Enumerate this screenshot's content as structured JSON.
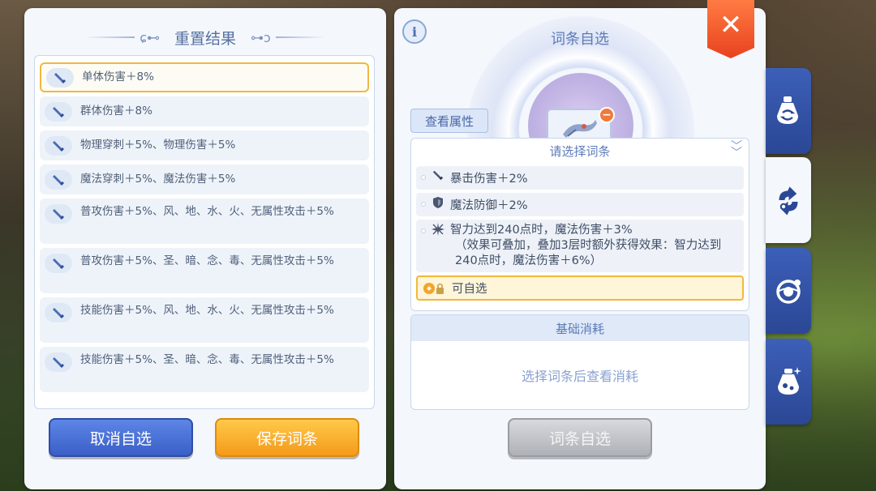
{
  "left_panel": {
    "title": "重置结果",
    "results": [
      {
        "text": "单体伤害＋8%",
        "selected": true
      },
      {
        "text": "群体伤害＋8%",
        "selected": false
      },
      {
        "text": "物理穿刺＋5%、物理伤害＋5%",
        "selected": false
      },
      {
        "text": "魔法穿刺＋5%、魔法伤害＋5%",
        "selected": false
      },
      {
        "text": "普攻伤害＋5%、风、地、水、火、无属性攻击＋5%",
        "selected": false
      },
      {
        "text": "普攻伤害＋5%、圣、暗、念、毒、无属性攻击＋5%",
        "selected": false
      },
      {
        "text": "技能伤害＋5%、风、地、水、火、无属性攻击＋5%",
        "selected": false
      },
      {
        "text": "技能伤害＋5%、圣、暗、念、毒、无属性攻击＋5%",
        "selected": false
      }
    ],
    "cancel_label": "取消自选",
    "save_label": "保存词条"
  },
  "right_panel": {
    "title": "词条自选",
    "view_attr_label": "查看属性",
    "affix_header": "请选择词条",
    "affixes": [
      {
        "icon": "sword-icon",
        "text": "暴击伤害＋2%"
      },
      {
        "icon": "shield-icon",
        "text": "魔法防御＋2%"
      },
      {
        "icon": "sparkle-icon",
        "text": "智力达到240点时，魔法伤害＋3%",
        "note": "（效果可叠加，叠加3层时额外获得效果：智力达到240点时，魔法伤害＋6%）"
      }
    ],
    "selectable_label": "可自选",
    "cost_header": "基础消耗",
    "cost_hint": "选择词条后查看消耗",
    "confirm_label": "词条自选"
  },
  "side_tabs": [
    {
      "icon": "potion-refresh-icon",
      "active": false
    },
    {
      "icon": "refresh-cycle-icon",
      "active": true
    },
    {
      "icon": "orb-icon",
      "active": false
    },
    {
      "icon": "flask-sparkle-icon",
      "active": false
    }
  ],
  "colors": {
    "accent_blue": "#3a5fc7",
    "accent_orange": "#f59a1a",
    "close_red": "#e8421e",
    "highlight_gold": "#f0b840"
  }
}
